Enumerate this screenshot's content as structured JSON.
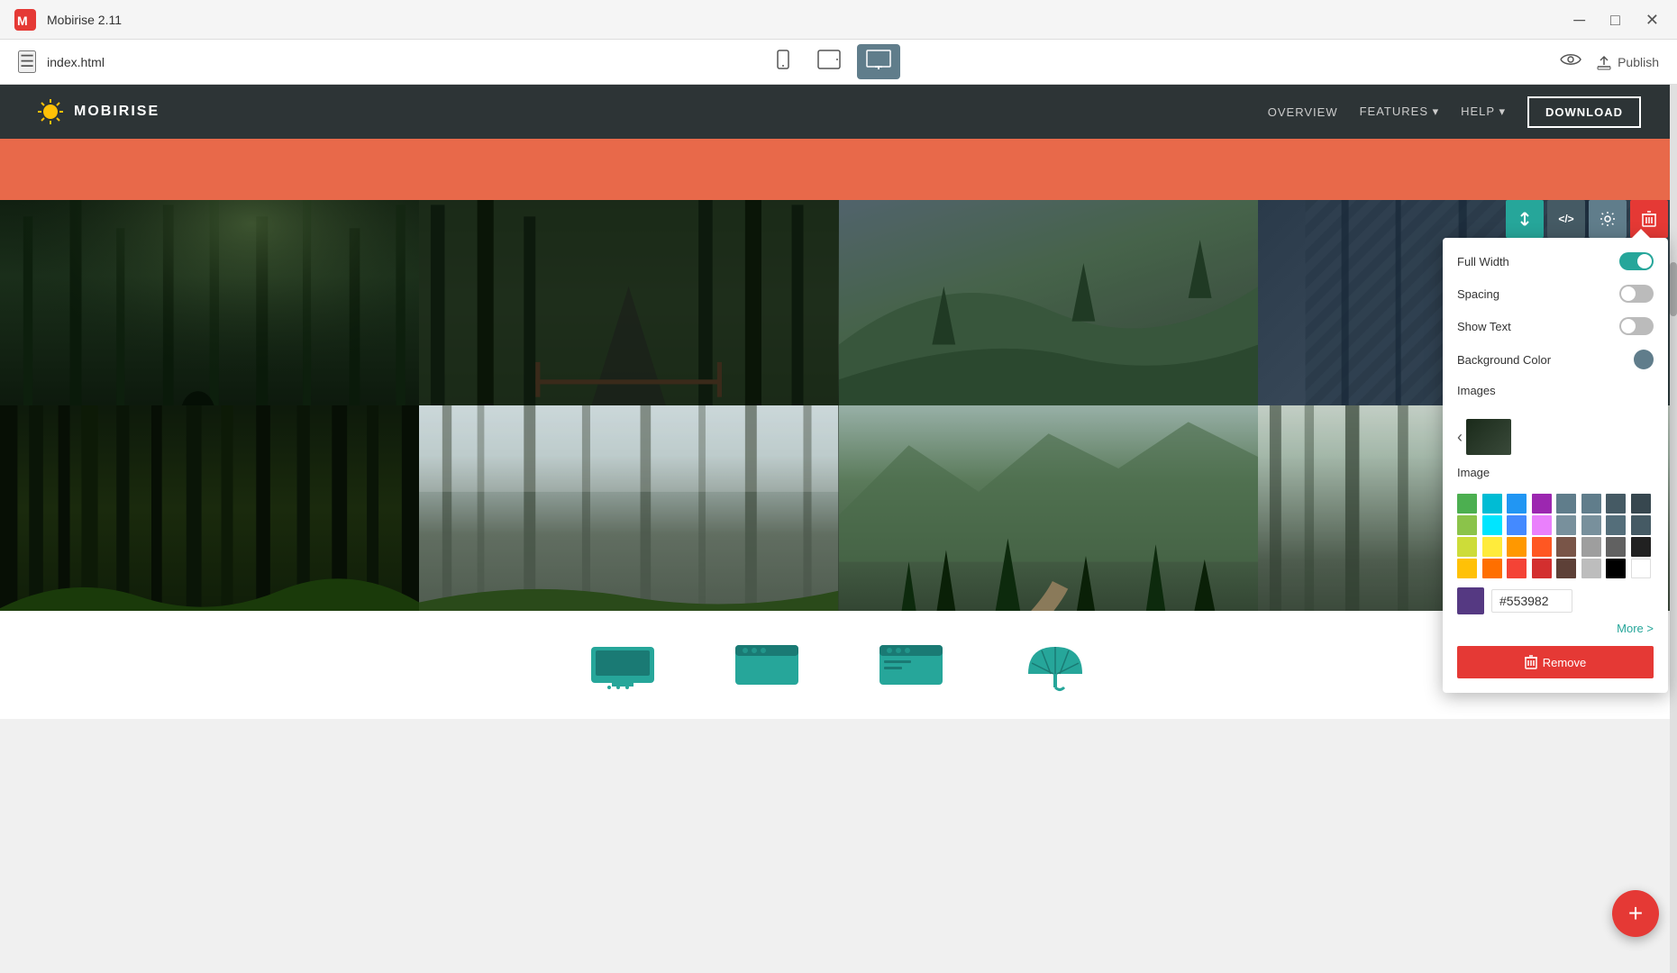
{
  "titleBar": {
    "appName": "Mobirise 2.11",
    "minimize": "─",
    "maximize": "□",
    "close": "✕"
  },
  "toolbar": {
    "hamburgerLabel": "☰",
    "fileName": "index.html",
    "mobileIcon": "📱",
    "tabletIcon": "⬜",
    "desktopIcon": "🖥",
    "previewIcon": "👁",
    "publishLabel": "Publish",
    "uploadIcon": "⬆"
  },
  "preview": {
    "navbar": {
      "brandName": "MOBIRISE",
      "links": [
        "OVERVIEW",
        "FEATURES ▾",
        "HELP ▾"
      ],
      "downloadBtn": "DOWNLOAD"
    },
    "gallery": {
      "rows": [
        [
          "forest-1",
          "forest-2",
          "forest-3",
          "forest-4"
        ],
        [
          "forest-5",
          "forest-6",
          "forest-7",
          "forest-8"
        ]
      ]
    }
  },
  "blockToolbar": {
    "buttons": [
      {
        "id": "arrange",
        "icon": "⇅",
        "class": "teal"
      },
      {
        "id": "code",
        "icon": "</>",
        "class": "dark"
      },
      {
        "id": "settings",
        "icon": "⚙",
        "class": "gear"
      },
      {
        "id": "delete",
        "icon": "🗑",
        "class": "red"
      }
    ]
  },
  "settingsPanel": {
    "fullWidthLabel": "Full Width",
    "fullWidthOn": true,
    "spacingLabel": "Spacing",
    "spacingOn": false,
    "showTextLabel": "Show Text",
    "showTextOn": false,
    "backgroundColorLabel": "Background Color",
    "imagesLabel": "Images",
    "imageLabel": "Image",
    "colorHex": "#553982",
    "moreLabel": "More >",
    "removeLabel": "Remove",
    "colors": [
      "#4CAF50",
      "#00BCD4",
      "#2196F3",
      "#9C27B0",
      "#607D8B",
      "#8BC34A",
      "#00E5FF",
      "#448AFF",
      "#E040FB",
      "#455A64",
      "#CDDC39",
      "#FFEB3B",
      "#FF9800",
      "#FF5722",
      "#795548",
      "#FFC107",
      "#FF6F00",
      "#F44336",
      "#9E9E9E",
      "#212121",
      "#000000",
      "#ffffff"
    ]
  },
  "fab": {
    "label": "+"
  }
}
